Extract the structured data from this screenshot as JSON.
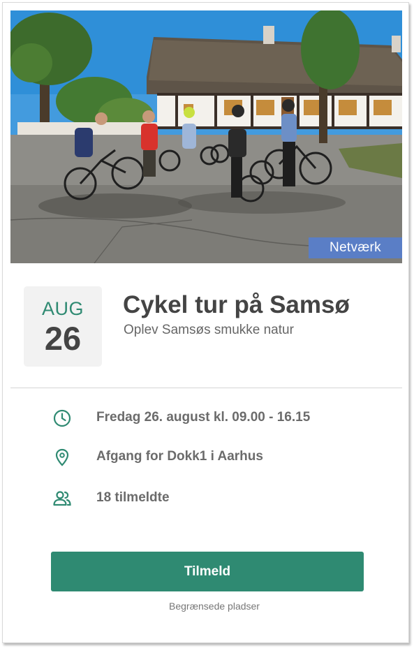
{
  "event": {
    "photo_alt": "",
    "category_badge": "Netværk",
    "date": {
      "month": "AUG",
      "day": "26"
    },
    "title": "Cykel tur på Samsø",
    "subtitle": "Oplev Samsøs smukke natur",
    "details": {
      "time": {
        "icon": "clock-icon",
        "text": "Fredag 26. august kl. 09.00 - 16.15"
      },
      "location": {
        "icon": "location-pin-icon",
        "text": "Afgang for Dokk1 i Aarhus"
      },
      "attendees": {
        "icon": "people-icon",
        "text": "18 tilmeldte"
      }
    },
    "cta_label": "Tilmeld",
    "note": "Begrænsede pladser"
  },
  "colors": {
    "accent": "#2f8a72",
    "badge": "#5a7ec6",
    "title_text": "#444444",
    "detail_text": "#6b6b6b",
    "date_box_bg": "#f2f2f2"
  }
}
